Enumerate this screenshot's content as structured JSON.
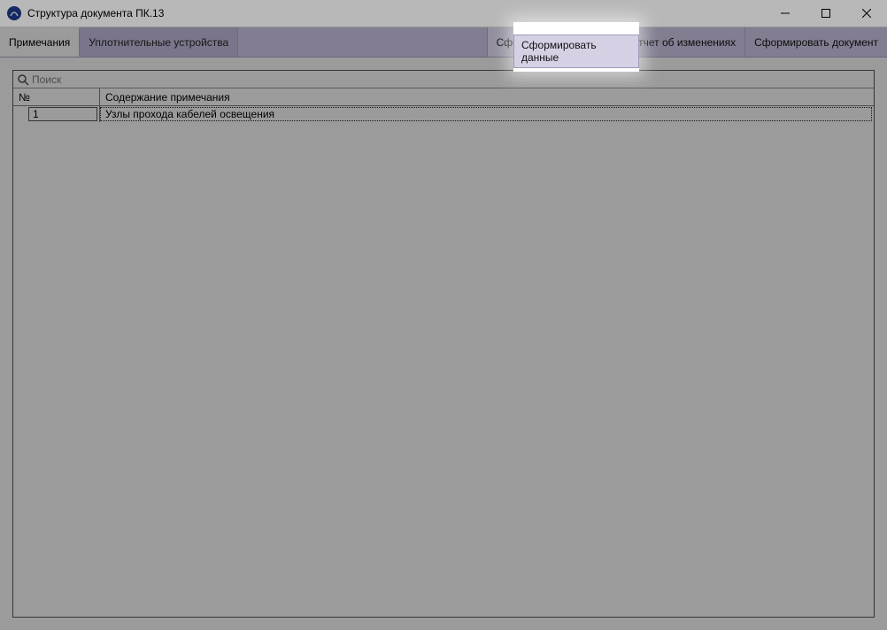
{
  "window": {
    "title": "Структура документа ПК.13"
  },
  "tabs": {
    "notes": "Примечания",
    "seals": "Уплотнительные устройства"
  },
  "actions": {
    "generate_data": "Сформировать данные",
    "change_report": "Отчет об изменениях",
    "generate_doc": "Сформировать документ"
  },
  "search": {
    "placeholder": "Поиск"
  },
  "table": {
    "headers": {
      "num": "№",
      "content": "Содержание примечания"
    },
    "rows": [
      {
        "num": "1",
        "content": "Узлы прохода кабелей освещения"
      }
    ]
  }
}
